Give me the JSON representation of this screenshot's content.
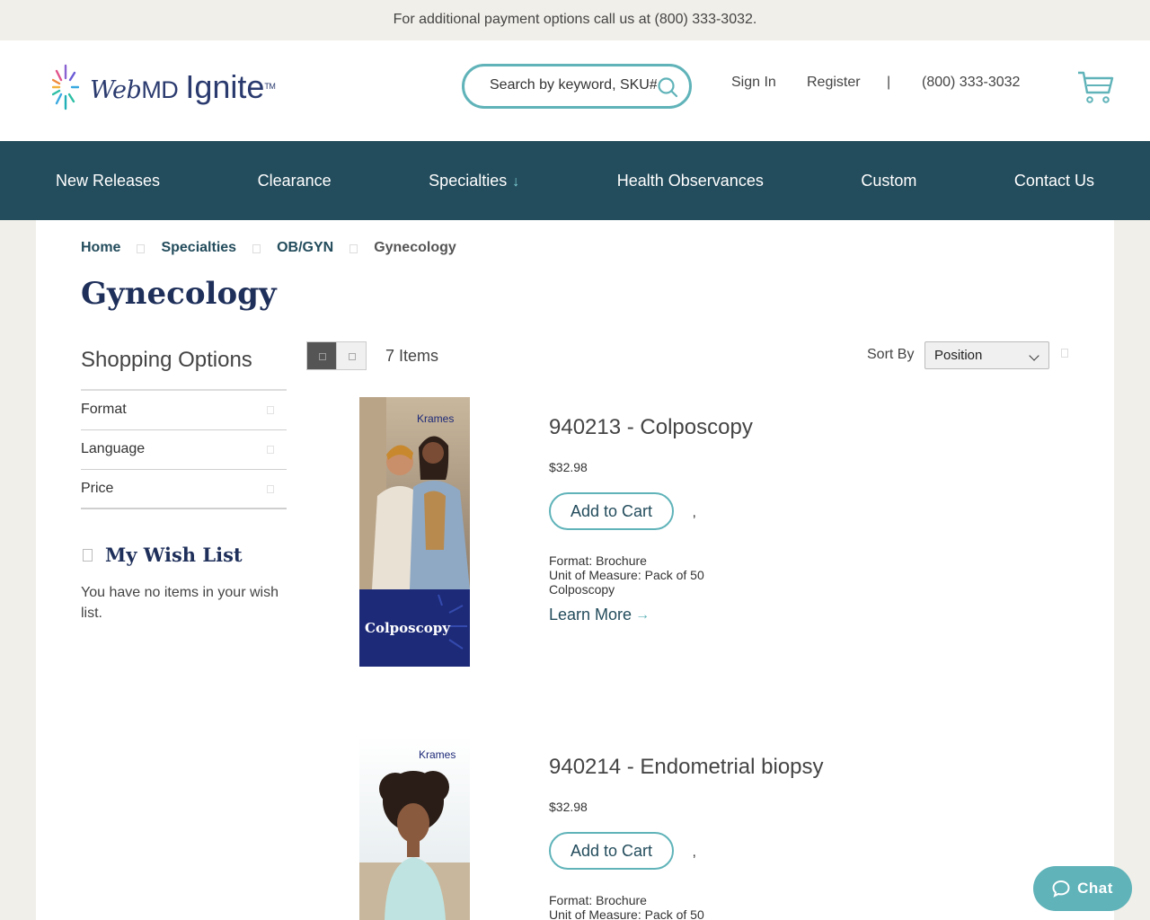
{
  "topbar": {
    "text": "For additional payment options call us at (800) 333-3032."
  },
  "header": {
    "logo": {
      "webmd_text": "WebMD",
      "web": "Web",
      "md": "MD",
      "ignite": "Ignite",
      "tm": "TM"
    },
    "search": {
      "placeholder": "Search by keyword, SKU#"
    },
    "sign_in": "Sign In",
    "register": "Register",
    "divider": "|",
    "phone": "(800) 333-3032"
  },
  "nav": {
    "items": [
      {
        "label": "New Releases"
      },
      {
        "label": "Clearance"
      },
      {
        "label": "Specialties"
      },
      {
        "label": "Health Observances"
      },
      {
        "label": "Custom"
      },
      {
        "label": "Contact Us"
      }
    ]
  },
  "breadcrumb": {
    "items": [
      "Home",
      "Specialties",
      "OB/GYN"
    ],
    "current": "Gynecology"
  },
  "page": {
    "title": "Gynecology"
  },
  "sidebar": {
    "title": "Shopping Options",
    "filters": [
      "Format",
      "Language",
      "Price"
    ],
    "wishlist": {
      "title": "My Wish List",
      "empty_text": "You have no items in your wish list."
    }
  },
  "toolbar": {
    "count": "7 Items",
    "sort_label": "Sort By",
    "sort_value": "Position"
  },
  "products": [
    {
      "name": "940213 - Colposcopy",
      "price": "$32.98",
      "add_to_cart": "Add to Cart",
      "comma": ",",
      "format": "Format: Brochure",
      "uom": "Unit of Measure: Pack of 50",
      "desc": "Colposcopy",
      "learn_more": "Learn More",
      "thumb_brand": "Krames",
      "thumb_title": "Colposcopy"
    },
    {
      "name": "940214 - Endometrial biopsy",
      "price": "$32.98",
      "add_to_cart": "Add to Cart",
      "comma": ",",
      "format": "Format: Brochure",
      "uom": "Unit of Measure: Pack of 50",
      "thumb_brand": "Krames"
    }
  ],
  "chat": {
    "label": "Chat"
  },
  "colors": {
    "teal": "#5fb3b9",
    "navy": "#234c5c",
    "title_navy": "#1e2f5a",
    "beige": "#f1efe9"
  }
}
